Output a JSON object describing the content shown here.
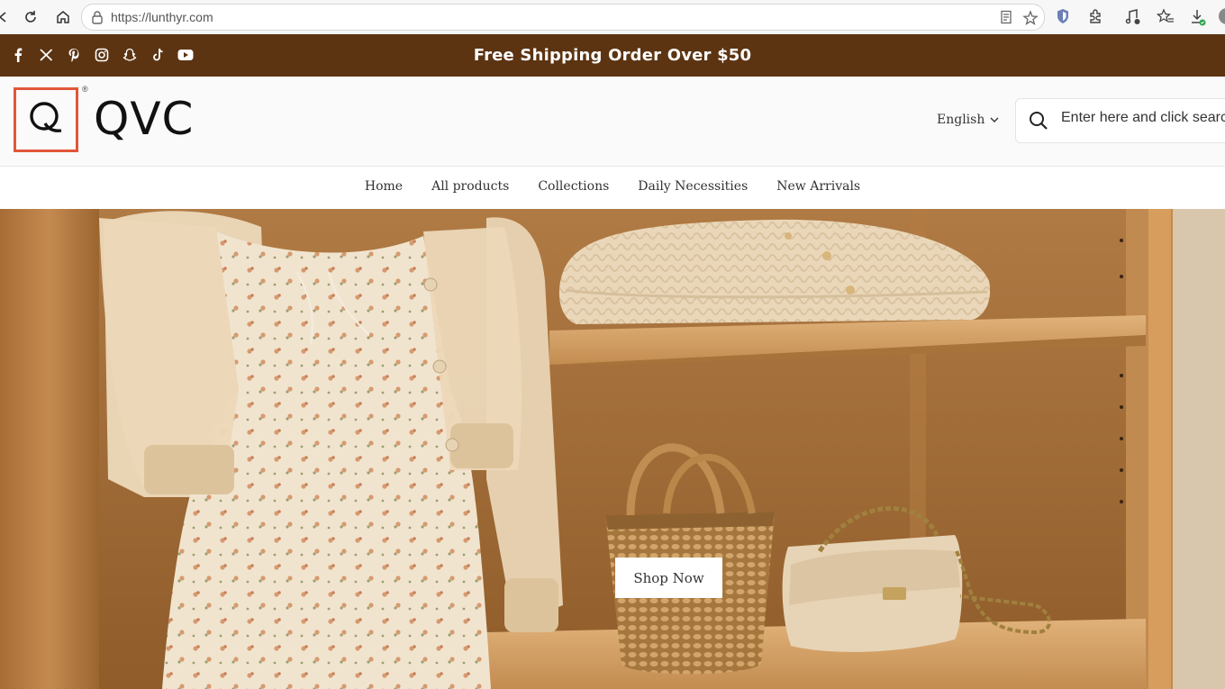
{
  "browser": {
    "url": "https://lunthyr.com"
  },
  "announcement": {
    "text": "Free Shipping Order Over $50",
    "social_icons": [
      "facebook-icon",
      "x-icon",
      "pinterest-icon",
      "instagram-icon",
      "snapchat-icon",
      "tiktok-icon",
      "youtube-icon"
    ]
  },
  "header": {
    "logo_text": "QVC",
    "logo_mark": "Q",
    "registered": "®",
    "language": "English",
    "search_placeholder": "Enter here and click search"
  },
  "nav": {
    "items": [
      "Home",
      "All products",
      "Collections",
      "Daily Necessities",
      "New Arrivals"
    ]
  },
  "hero": {
    "cta_label": "Shop Now"
  },
  "colors": {
    "announcement_bg": "#5c3412",
    "logo_accent": "#e1573a"
  }
}
